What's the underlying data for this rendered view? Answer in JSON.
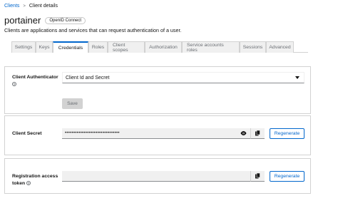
{
  "breadcrumb": {
    "link": "Clients",
    "separator": ">",
    "current": "Client details"
  },
  "header": {
    "title": "portainer",
    "badge": "OpenID Connect",
    "description": "Clients are applications and services that can request authentication of a user."
  },
  "tabs": [
    {
      "label": "Settings",
      "active": false
    },
    {
      "label": "Keys",
      "active": false
    },
    {
      "label": "Credentials",
      "active": true
    },
    {
      "label": "Roles",
      "active": false
    },
    {
      "label": "Client scopes",
      "active": false
    },
    {
      "label": "Authorization",
      "active": false
    },
    {
      "label": "Service accounts roles",
      "active": false
    },
    {
      "label": "Sessions",
      "active": false
    },
    {
      "label": "Advanced",
      "active": false
    }
  ],
  "authenticator": {
    "label": "Client Authenticator",
    "help": "?",
    "value": "Client Id and Secret",
    "save_label": "Save"
  },
  "secret": {
    "label": "Client Secret",
    "value": "••••••••••••••••••••••••••••••••",
    "regenerate_label": "Regenerate"
  },
  "registration": {
    "label_line1": "Registration access",
    "label_line2": "token",
    "help": "?",
    "regenerate_label": "Regenerate"
  },
  "icons": {
    "show": "eye-icon",
    "copy": "copy-icon",
    "dropdown": "caret-down-icon",
    "help": "help-icon"
  },
  "colors": {
    "accent": "#0066cc",
    "active_tab_border": "#0066cc",
    "disabled_button": "#d2d2d2"
  }
}
